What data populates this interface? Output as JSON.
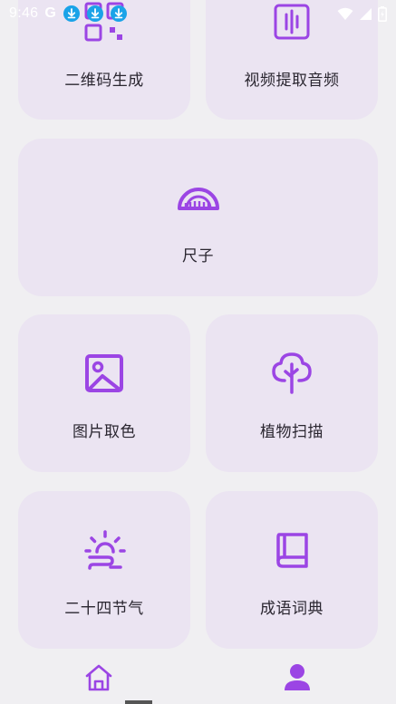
{
  "status_bar": {
    "time": "9:46",
    "carrier_icon": "google-g-icon",
    "notification_icons": [
      "download-icon",
      "download-icon",
      "download-icon"
    ],
    "system_icons": [
      "wifi-icon",
      "signal-icon",
      "battery-icon"
    ],
    "notification_color": "#1aa3e8"
  },
  "grid": {
    "accent_color": "#9b45e4",
    "card_color": "#ebe4f2",
    "cards": [
      {
        "label": "二维码生成",
        "icon": "qr-code-icon"
      },
      {
        "label": "视频提取音频",
        "icon": "audio-extract-icon"
      },
      {
        "label": "尺子",
        "icon": "ruler-protractor-icon"
      },
      {
        "label": "图片取色",
        "icon": "image-icon"
      },
      {
        "label": "植物扫描",
        "icon": "tree-icon"
      },
      {
        "label": "二十四节气",
        "icon": "sunrise-icon"
      },
      {
        "label": "成语词典",
        "icon": "book-icon"
      }
    ]
  },
  "bottom_nav": {
    "items": [
      {
        "name": "home",
        "icon": "home-icon"
      },
      {
        "name": "profile",
        "icon": "profile-icon"
      }
    ]
  }
}
